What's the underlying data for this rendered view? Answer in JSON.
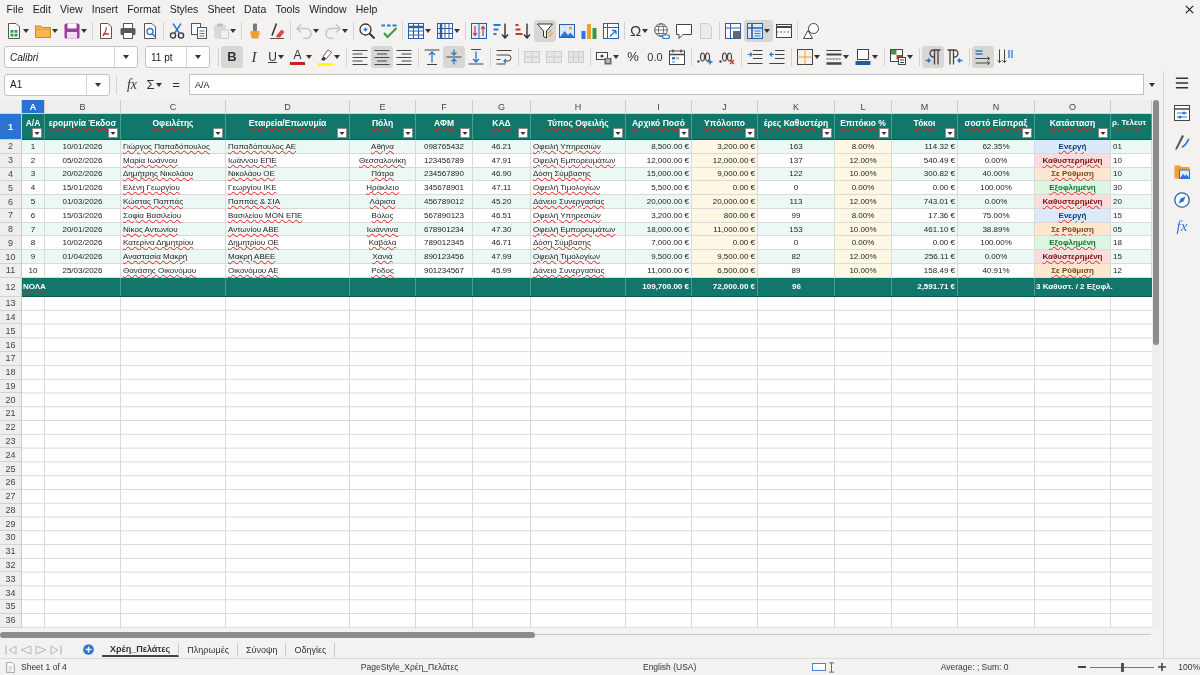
{
  "menu_bar": [
    "File",
    "Edit",
    "View",
    "Insert",
    "Format",
    "Styles",
    "Sheet",
    "Data",
    "Tools",
    "Window",
    "Help"
  ],
  "toolbar_standard": [
    [
      {
        "active": false,
        "disabled": false
      },
      {
        "active": false,
        "disabled": false
      },
      {
        "active": false,
        "disabled": false
      }
    ],
    [
      {
        "active": false,
        "disabled": false
      },
      {
        "active": false,
        "disabled": false
      },
      {
        "active": false,
        "disabled": false
      }
    ],
    [
      {
        "active": false,
        "disabled": false
      },
      {
        "active": false,
        "disabled": false
      },
      {
        "active": false,
        "disabled": true
      }
    ],
    [
      {
        "active": false,
        "disabled": false
      },
      {
        "active": false,
        "disabled": false
      }
    ],
    [
      {
        "active": false,
        "disabled": true
      },
      {
        "active": false,
        "disabled": true
      }
    ],
    [
      {
        "active": false,
        "disabled": false
      },
      {
        "active": false,
        "disabled": false
      }
    ],
    [
      {
        "active": false,
        "disabled": false
      },
      {
        "active": false,
        "disabled": false
      }
    ],
    [
      {
        "active": false,
        "disabled": false
      },
      {
        "active": false,
        "disabled": false
      },
      {
        "active": false,
        "disabled": false
      },
      {
        "active": true,
        "disabled": false
      },
      {
        "active": false,
        "disabled": false
      },
      {
        "active": false,
        "disabled": false
      },
      {
        "active": false,
        "disabled": false
      }
    ],
    [
      {
        "glyph": "Ω",
        "active": false,
        "disabled": false
      },
      {
        "active": false,
        "disabled": false
      },
      {
        "active": false,
        "disabled": false
      },
      {
        "active": false,
        "disabled": true
      }
    ],
    [
      {
        "active": false,
        "disabled": false
      },
      {
        "active": true,
        "disabled": false
      },
      {
        "active": false,
        "disabled": false
      }
    ],
    [
      {
        "active": false,
        "disabled": false
      }
    ]
  ],
  "toolbar_formatting": {
    "font_name": "Calibri",
    "font_size": "11 pt",
    "groups": [
      [
        {
          "glyph": "B",
          "active": true,
          "disabled": false
        },
        {
          "glyph": "I",
          "active": false,
          "disabled": false
        },
        {
          "glyph": "U",
          "active": false,
          "disabled": false
        },
        {
          "glyph": "A",
          "color": "#c9211e",
          "active": false,
          "disabled": false
        },
        {
          "color": "#ffff00",
          "active": false,
          "disabled": false
        }
      ],
      [
        {
          "active": false,
          "disabled": false
        },
        {
          "active": true,
          "disabled": false
        },
        {
          "active": false,
          "disabled": false
        }
      ],
      [
        {
          "active": false,
          "disabled": false
        },
        {
          "active": true,
          "disabled": false
        },
        {
          "active": false,
          "disabled": false
        }
      ],
      [
        {
          "active": false,
          "disabled": false
        }
      ],
      [
        {
          "active": false,
          "disabled": true
        },
        {
          "active": false,
          "disabled": true
        },
        {
          "active": false,
          "disabled": true
        }
      ],
      [
        {
          "active": false,
          "disabled": false
        },
        {
          "glyph": "%",
          "active": false,
          "disabled": false
        },
        {
          "glyph": "0.0",
          "active": false,
          "disabled": false
        },
        {
          "active": false,
          "disabled": false
        }
      ],
      [
        {
          "active": false,
          "disabled": false
        },
        {
          "active": false,
          "disabled": false
        }
      ],
      [
        {
          "active": false,
          "disabled": false
        },
        {
          "active": false,
          "disabled": false
        }
      ],
      [
        {
          "active": false,
          "disabled": false
        },
        {
          "active": false,
          "disabled": false
        },
        {
          "active": false,
          "disabled": false
        }
      ],
      [
        {
          "active": false,
          "disabled": false
        }
      ],
      [
        {
          "active": true,
          "disabled": false
        },
        {
          "active": false,
          "disabled": false
        }
      ],
      [
        {
          "active": true,
          "disabled": false
        },
        {
          "active": false,
          "disabled": false
        }
      ]
    ]
  },
  "formula_bar": {
    "name_box": "A1",
    "function_glyph": "fx",
    "sum_glyph": "Σ",
    "equals_glyph": "=",
    "formula": "A/A"
  },
  "sidebar": {
    "functions_glyph": "fx"
  },
  "grid": {
    "columns": [
      {
        "letter": "A",
        "selected": true,
        "header": "Α/Α",
        "header_flagged": false,
        "cells_flagged": false,
        "filter_button": true
      },
      {
        "letter": "B",
        "selected": false,
        "header": "ερομηνία Έκδοσ",
        "header_flagged": true,
        "cells_flagged": false,
        "filter_button": true
      },
      {
        "letter": "C",
        "selected": false,
        "header": "Οφειλέτης",
        "header_flagged": true,
        "cells_flagged": true,
        "filter_button": true
      },
      {
        "letter": "D",
        "selected": false,
        "header": "Εταιρεία/Επωνυμία",
        "header_flagged": true,
        "cells_flagged": true,
        "filter_button": true
      },
      {
        "letter": "E",
        "selected": false,
        "header": "Πόλη",
        "header_flagged": true,
        "cells_flagged": true,
        "filter_button": true
      },
      {
        "letter": "F",
        "selected": false,
        "header": "ΑΦΜ",
        "header_flagged": true,
        "cells_flagged": false,
        "filter_button": true
      },
      {
        "letter": "G",
        "selected": false,
        "header": "ΚΑΔ",
        "header_flagged": true,
        "cells_flagged": false,
        "filter_button": true
      },
      {
        "letter": "H",
        "selected": false,
        "header": "Τύπος Οφειλής",
        "header_flagged": true,
        "cells_flagged": true,
        "filter_button": true
      },
      {
        "letter": "I",
        "selected": false,
        "header": "Αρχικό Ποσό",
        "header_flagged": true,
        "cells_flagged": false,
        "filter_button": true
      },
      {
        "letter": "J",
        "selected": false,
        "header": "Υπόλοιπο",
        "header_flagged": true,
        "cells_flagged": false,
        "filter_button": true,
        "color": "#fdf7e3"
      },
      {
        "letter": "K",
        "selected": false,
        "header": "έρες Καθυστέρη",
        "header_flagged": true,
        "cells_flagged": false,
        "filter_button": true
      },
      {
        "letter": "L",
        "selected": false,
        "header": "Επιτόκιο %",
        "header_flagged": true,
        "cells_flagged": false,
        "filter_button": true,
        "color": "#fdf7e3"
      },
      {
        "letter": "M",
        "selected": false,
        "header": "Τόκοι",
        "header_flagged": true,
        "cells_flagged": false,
        "filter_button": true
      },
      {
        "letter": "N",
        "selected": false,
        "header": "σοστό Είσπραξ",
        "header_flagged": true,
        "cells_flagged": false,
        "filter_button": true
      },
      {
        "letter": "O",
        "selected": false,
        "header": "Κατάσταση",
        "header_flagged": true,
        "cells_flagged": true,
        "filter_button": true
      },
      {
        "selected": false,
        "header": "ρ. Τελευτ",
        "header_flagged": true,
        "cells_flagged": false,
        "filter_button": false
      }
    ],
    "header_row": {
      "number": "1",
      "selected": true
    },
    "rows": [
      {
        "number": "2",
        "selected": false,
        "color": "#dce9fa",
        "cells": [
          "1",
          "10/01/2026",
          "Γιώργος Παπαδόπουλος",
          "Παπαδόπουλος ΑΕ",
          "Αθήνα",
          "098765432",
          "46.21",
          "Οφειλή Υπηρεσιών",
          "8,500.00 €",
          "3,200.00 €",
          "163",
          "8.00%",
          "114.32 €",
          "62.35%",
          "Ενεργή",
          "01"
        ]
      },
      {
        "number": "3",
        "selected": false,
        "color": "#fadcdc",
        "cells": [
          "2",
          "05/02/2026",
          "Μαρία Ιωάννου",
          "Ιωάννου ΕΠΕ",
          "Θεσσαλονίκη",
          "123456789",
          "47.91",
          "Οφειλή Εμπορευμάτων",
          "12,000.00 €",
          "12,000.00 €",
          "137",
          "12.00%",
          "540.49 €",
          "0.00%",
          "Καθυστερημένη",
          "10"
        ]
      },
      {
        "number": "4",
        "selected": false,
        "color": "#fde7d0",
        "cells": [
          "3",
          "20/02/2026",
          "Δημήτρης Νικολάου",
          "Νικολάου ΟΕ",
          "Πάτρα",
          "234567890",
          "46.90",
          "Δόση Σύμβασης",
          "15,000.00 €",
          "9,000.00 €",
          "122",
          "10.00%",
          "300.82 €",
          "40.00%",
          "Σε Ρύθμιση",
          "10"
        ]
      },
      {
        "number": "5",
        "selected": false,
        "color": "#dcf6e2",
        "cells": [
          "4",
          "15/01/2026",
          "Ελένη Γεωργίου",
          "Γεωργίου ΙΚΕ",
          "Ηράκλειο",
          "345678901",
          "47.11",
          "Οφειλή Τιμολογίων",
          "5,500.00 €",
          "0.00 €",
          "0",
          "0.00%",
          "0.00 €",
          "100.00%",
          "Εξοφλημένη",
          "30"
        ]
      },
      {
        "number": "6",
        "selected": false,
        "color": "#fadcdc",
        "cells": [
          "5",
          "01/03/2026",
          "Κώστας Παππάς",
          "Παππάς & ΣΙΑ",
          "Λάρισα",
          "456789012",
          "45.20",
          "Δάνειο Συνεργασίας",
          "20,000.00 €",
          "20,000.00 €",
          "113",
          "12.00%",
          "743.01 €",
          "0.00%",
          "Καθυστερημένη",
          "20"
        ]
      },
      {
        "number": "7",
        "selected": false,
        "color": "#dce9fa",
        "cells": [
          "6",
          "15/03/2026",
          "Σοφία Βασιλείου",
          "Βασιλείου ΜΟΝ ΕΠΕ",
          "Βόλος",
          "567890123",
          "46.51",
          "Οφειλή Υπηρεσιών",
          "3,200.00 €",
          "800.00 €",
          "99",
          "8.00%",
          "17.36 €",
          "75.00%",
          "Ενεργή",
          "15"
        ]
      },
      {
        "number": "8",
        "selected": false,
        "color": "#fde7d0",
        "cells": [
          "7",
          "20/01/2026",
          "Νίκος Αντωνίου",
          "Αντωνίου ΑΒΕ",
          "Ιωάννινα",
          "678901234",
          "47.30",
          "Οφειλή Εμπορευμάτων",
          "18,000.00 €",
          "11,000.00 €",
          "153",
          "10.00%",
          "461.10 €",
          "38.89%",
          "Σε Ρύθμιση",
          "05"
        ]
      },
      {
        "number": "9",
        "selected": false,
        "color": "#dcf6e2",
        "cells": [
          "8",
          "10/02/2026",
          "Κατερίνα Δημητρίου",
          "Δημητρίου ΟΕ",
          "Καβάλα",
          "789012345",
          "46.71",
          "Δόση Σύμβασης",
          "7,000.00 €",
          "0.00 €",
          "0",
          "0.00%",
          "0.00 €",
          "100.00%",
          "Εξοφλημένη",
          "18"
        ]
      },
      {
        "number": "10",
        "selected": false,
        "color": "#fadcdc",
        "cells": [
          "9",
          "01/04/2026",
          "Αναστασία Μακρή",
          "Μακρή ΑΒΕΕ",
          "Χανιά",
          "890123456",
          "47.99",
          "Οφειλή Τιμολογίων",
          "9,500.00 €",
          "9,500.00 €",
          "82",
          "12.00%",
          "256.11 €",
          "0.00%",
          "Καθυστερημένη",
          "15"
        ]
      },
      {
        "number": "11",
        "selected": false,
        "color": "#fde7d0",
        "cells": [
          "10",
          "25/03/2026",
          "Θανάσης Οικονόμου",
          "Οικονόμου ΑΕ",
          "Ρόδος",
          "901234567",
          "45.99",
          "Δάνειο Συνεργασίας",
          "11,000.00 €",
          "6,500.00 €",
          "89",
          "10.00%",
          "158.49 €",
          "40.91%",
          "Σε Ρύθμιση",
          "12"
        ]
      }
    ],
    "totals": {
      "number": "12",
      "selected": false,
      "label": "ΝΟΛΑ",
      "label_flagged": true,
      "initial_amount": "109,700.00 €",
      "balance": "72,000.00 €",
      "delay_days": "96",
      "interest": "2,591.71 €",
      "status": "3 Καθυστ. / 2 Εξοφλ."
    },
    "empty_rows": [
      {
        "number": "13",
        "selected": false
      },
      {
        "number": "14",
        "selected": false
      },
      {
        "number": "15",
        "selected": false
      },
      {
        "number": "16",
        "selected": false
      },
      {
        "number": "17",
        "selected": false
      },
      {
        "number": "18",
        "selected": false
      },
      {
        "number": "19",
        "selected": false
      },
      {
        "number": "20",
        "selected": false
      },
      {
        "number": "21",
        "selected": false
      },
      {
        "number": "22",
        "selected": false
      },
      {
        "number": "23",
        "selected": false
      },
      {
        "number": "24",
        "selected": false
      },
      {
        "number": "25",
        "selected": false
      },
      {
        "number": "26",
        "selected": false
      },
      {
        "number": "27",
        "selected": false
      },
      {
        "number": "28",
        "selected": false
      },
      {
        "number": "29",
        "selected": false
      },
      {
        "number": "30",
        "selected": false
      },
      {
        "number": "31",
        "selected": false
      },
      {
        "number": "32",
        "selected": false
      },
      {
        "number": "33",
        "selected": false
      },
      {
        "number": "34",
        "selected": false
      },
      {
        "number": "35",
        "selected": false
      },
      {
        "number": "36",
        "selected": false
      }
    ]
  },
  "sheet_nav": [
    {
      "disabled": true
    },
    {
      "disabled": true
    },
    {
      "disabled": true
    },
    {
      "disabled": true
    }
  ],
  "sheet_tabs": [
    {
      "label": "Χρέη_Πελάτες",
      "selected": true
    },
    {
      "label": "Πληρωμές",
      "selected": false
    },
    {
      "label": "Σύνοψη",
      "selected": false
    },
    {
      "label": "Οδηγίες",
      "selected": false
    }
  ],
  "status_bar": {
    "sheet": "Sheet 1 of 4",
    "page_style": "PageStyle_Χρέη_Πελάτες",
    "language": "English (USA)",
    "selection_summary": "Average: ; Sum: 0",
    "zoom": "100%",
    "zoom_slider": {
      "level": 0.5
    }
  }
}
